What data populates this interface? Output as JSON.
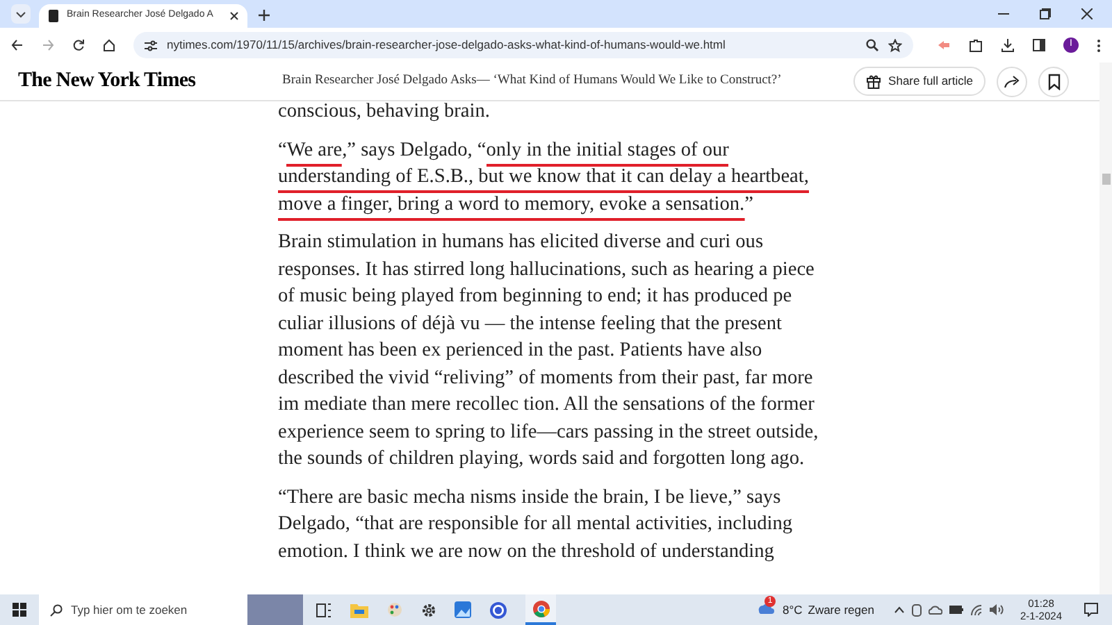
{
  "browser": {
    "tab": {
      "title": "Brain Researcher José Delgado A",
      "selected": true
    },
    "url": "nytimes.com/1970/11/15/archives/brain-researcher-jose-delgado-asks-what-kind-of-humans-would-we.html",
    "profile_initial": "I"
  },
  "site_header": {
    "logo": "The New York Times",
    "headline": "Brain Researcher José Delgado Asks— ‘What Kind of Humans Would We Like to Construct?’",
    "share_button": "Share full article"
  },
  "article": {
    "paragraphs": [
      {
        "segments": [
          {
            "text": "conscious, behaving brain."
          }
        ]
      },
      {
        "segments": [
          {
            "text": "“",
            "underlined": false
          },
          {
            "text": "We are",
            "underlined": true
          },
          {
            "text": ",” says Delgado, “",
            "underlined": false
          },
          {
            "text": "only in the initial stages of our understanding of E.S.B., but we know that it can delay a heartbeat, move a finger, bring a word to memory, evoke a sensation.",
            "underlined": true
          },
          {
            "text": "”",
            "underlined": false
          }
        ]
      },
      {
        "segments": [
          {
            "text": "Brain stimulation in humans has elicited diverse and curi ous responses. It has stirred long hallucinations, such as hearing a piece of music being played from beginning to end; it has produced pe culiar illusions of déjà vu — the intense feeling that the present moment has been ex perienced in the past. Patients have also described the vivid “reliving” of moments from their past, far more im mediate than mere recollec tion. All the sensations of the former experience seem to spring to life—cars passing in the street outside, the sounds of children playing, words said and forgotten long ago."
          }
        ]
      },
      {
        "segments": [
          {
            "text": "“There are basic mecha nisms inside the brain, I be lieve,” says Delgado, “that are responsible for all mental activities, including emotion. I think we are now on the threshold of understanding"
          }
        ]
      }
    ]
  },
  "taskbar": {
    "search_placeholder": "Typ hier om te zoeken",
    "weather": {
      "badge": "1",
      "temperature": "8°C",
      "condition": "Zware regen"
    },
    "time": "01:28",
    "date": "2-1-2024"
  }
}
